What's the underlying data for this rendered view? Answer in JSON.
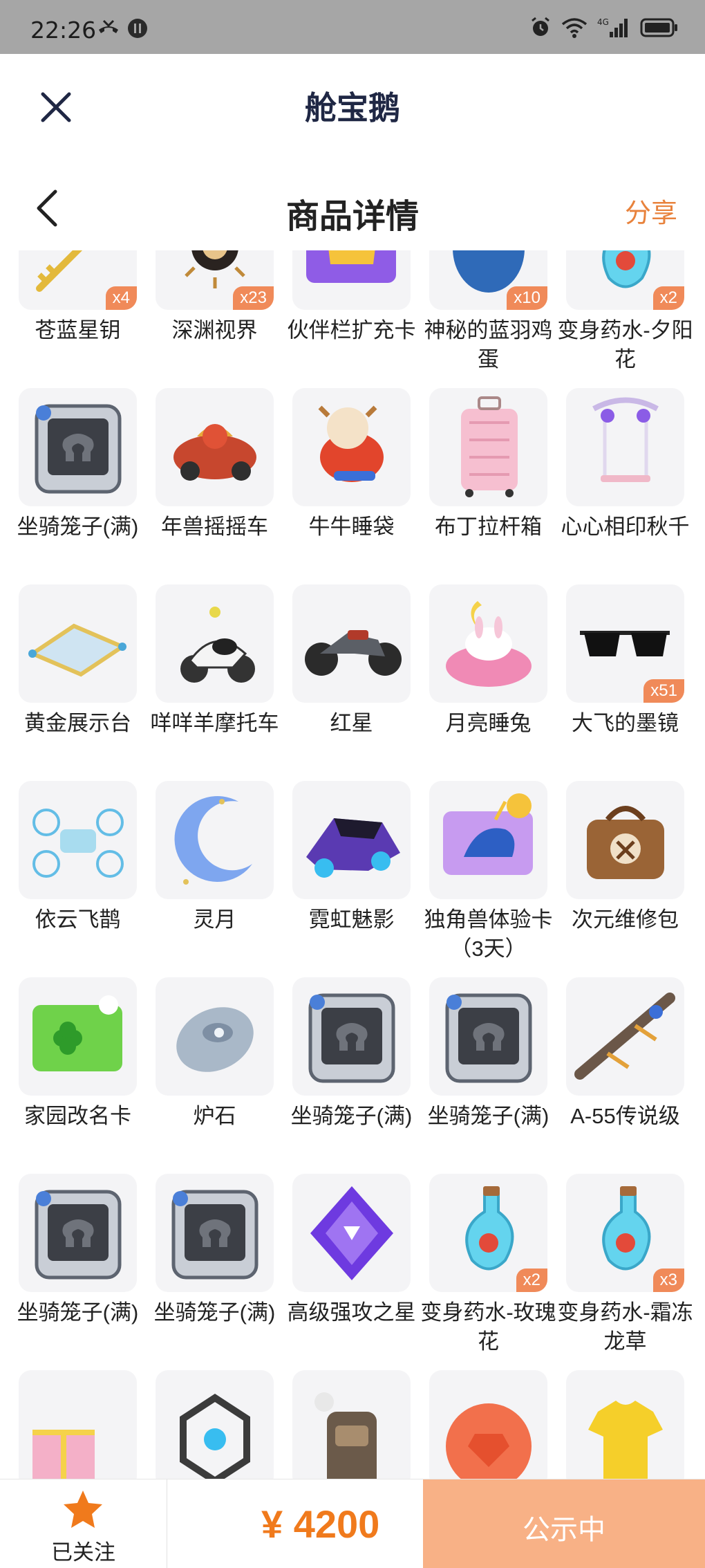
{
  "status_bar": {
    "time": "22:26",
    "network": "4G"
  },
  "header": {
    "title": "舱宝鹅"
  },
  "nav": {
    "title": "商品详情",
    "share_label": "分享"
  },
  "items": [
    {
      "name": "苍蓝星钥",
      "badge": "x4",
      "icon": "key-icon"
    },
    {
      "name": "深渊视界",
      "badge": "x23",
      "icon": "sun-eye-icon"
    },
    {
      "name": "伙伴栏扩充卡",
      "badge": "",
      "icon": "crown-card-icon"
    },
    {
      "name": "神秘的蓝羽鸡蛋",
      "badge": "x10",
      "icon": "blue-egg-icon"
    },
    {
      "name": "变身药水-夕阳花",
      "badge": "x2",
      "icon": "potion-icon"
    },
    {
      "name": "坐骑笼子(满)",
      "badge": "",
      "icon": "cage-icon"
    },
    {
      "name": "年兽摇摇车",
      "badge": "",
      "icon": "beast-cart-icon"
    },
    {
      "name": "牛牛睡袋",
      "badge": "",
      "icon": "cow-sleeping-bag-icon"
    },
    {
      "name": "布丁拉杆箱",
      "badge": "",
      "icon": "suitcase-icon"
    },
    {
      "name": "心心相印秋千",
      "badge": "",
      "icon": "swing-icon"
    },
    {
      "name": "黄金展示台",
      "badge": "",
      "icon": "display-stand-icon"
    },
    {
      "name": "咩咩羊摩托车",
      "badge": "",
      "icon": "sheep-motorbike-icon"
    },
    {
      "name": "红星",
      "badge": "",
      "icon": "motorcycle-icon"
    },
    {
      "name": "月亮睡兔",
      "badge": "",
      "icon": "moon-rabbit-icon"
    },
    {
      "name": "大飞的墨镜",
      "badge": "x51",
      "icon": "sunglasses-icon"
    },
    {
      "name": "依云飞鹊",
      "badge": "",
      "icon": "drone-icon"
    },
    {
      "name": "灵月",
      "badge": "",
      "icon": "crescent-moon-icon"
    },
    {
      "name": "霓虹魅影",
      "badge": "",
      "icon": "neon-car-icon"
    },
    {
      "name": "独角兽体验卡（3天）",
      "badge": "",
      "icon": "unicorn-card-icon"
    },
    {
      "name": "次元维修包",
      "badge": "",
      "icon": "repair-bag-icon"
    },
    {
      "name": "家园改名卡",
      "badge": "",
      "icon": "clover-card-icon"
    },
    {
      "name": "炉石",
      "badge": "",
      "icon": "hearthstone-icon"
    },
    {
      "name": "坐骑笼子(满)",
      "badge": "",
      "icon": "cage-icon"
    },
    {
      "name": "坐骑笼子(满)",
      "badge": "",
      "icon": "cage-icon"
    },
    {
      "name": "A-55传说级",
      "badge": "",
      "icon": "rifle-icon"
    },
    {
      "name": "坐骑笼子(满)",
      "badge": "",
      "icon": "cage-icon"
    },
    {
      "name": "坐骑笼子(满)",
      "badge": "",
      "icon": "cage-icon"
    },
    {
      "name": "高级强攻之星",
      "badge": "",
      "icon": "purple-gem-icon"
    },
    {
      "name": "变身药水-玫瑰花",
      "badge": "x2",
      "icon": "potion-icon"
    },
    {
      "name": "变身药水-霜冻龙草",
      "badge": "x3",
      "icon": "potion-icon"
    },
    {
      "name": "",
      "badge": "",
      "icon": "gift-box-icon"
    },
    {
      "name": "",
      "badge": "",
      "icon": "cube-frame-icon"
    },
    {
      "name": "",
      "badge": "",
      "icon": "backpack-icon"
    },
    {
      "name": "",
      "badge": "",
      "icon": "orange-coin-icon"
    },
    {
      "name": "",
      "badge": "",
      "icon": "yellow-shirt-icon"
    }
  ],
  "bottom": {
    "follow_label": "已关注",
    "price": "¥ 4200",
    "publish_label": "公示中"
  },
  "colors": {
    "accent": "#e8823c",
    "price": "#f07a1c",
    "badge": "#f08a59",
    "publish_bg": "#f8b186",
    "title": "#1f2744"
  }
}
